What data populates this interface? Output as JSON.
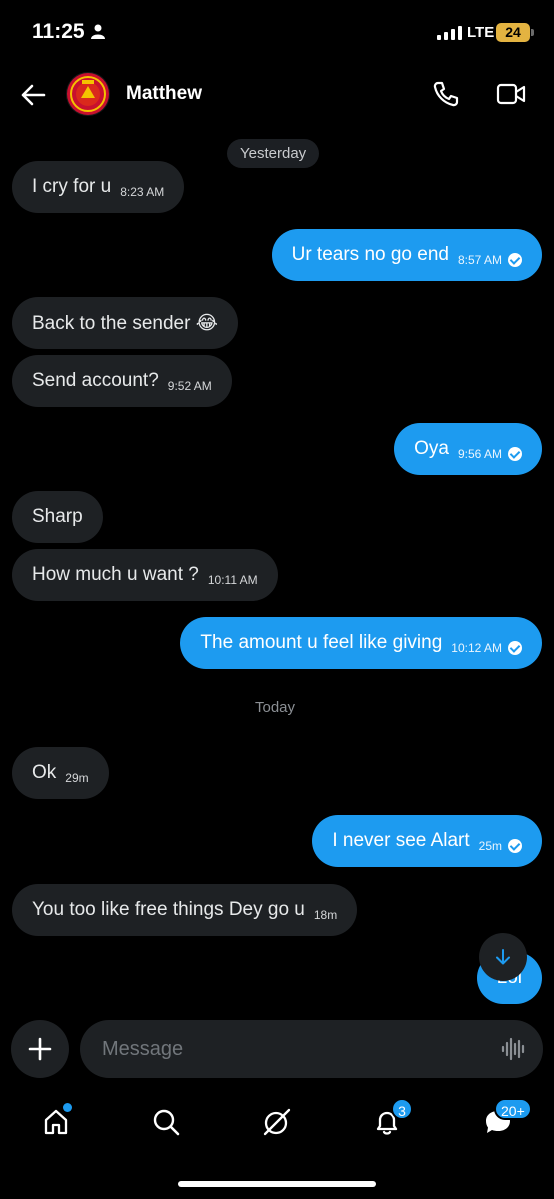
{
  "status_bar": {
    "time": "11:25",
    "network": "LTE",
    "battery": "24"
  },
  "header": {
    "contact_name": "Matthew"
  },
  "days": {
    "yesterday": "Yesterday",
    "today": "Today"
  },
  "messages": [
    {
      "direction": "in",
      "text": "I cry for u",
      "time": "8:23 AM"
    },
    {
      "direction": "out",
      "text": "Ur tears no go end",
      "time": "8:57 AM",
      "read": true
    },
    {
      "direction": "in",
      "text": "Back to the sender 😂",
      "time": ""
    },
    {
      "direction": "in",
      "text": "Send account?",
      "time": "9:52 AM"
    },
    {
      "direction": "out",
      "text": "Oya",
      "time": "9:56 AM",
      "read": true
    },
    {
      "direction": "in",
      "text": "Sharp",
      "time": ""
    },
    {
      "direction": "in",
      "text": "How much u want ?",
      "time": "10:11 AM"
    },
    {
      "direction": "out",
      "text": "The amount u feel like giving",
      "time": "10:12 AM",
      "read": true
    },
    {
      "direction": "in",
      "text": "Ok",
      "time": "29m"
    },
    {
      "direction": "out",
      "text": "I never see Alart",
      "time": "25m",
      "read": true
    },
    {
      "direction": "in",
      "text": "You too like free things Dey go u",
      "time": "18m"
    },
    {
      "direction": "out",
      "text": "Lol",
      "time": ""
    }
  ],
  "composer": {
    "placeholder": "Message"
  },
  "nav": {
    "items": [
      "home-icon",
      "search-icon",
      "grok-icon",
      "notifications-icon",
      "messages-icon"
    ],
    "notifications_badge": "3",
    "messages_badge": "20+"
  },
  "colors": {
    "accent": "#1d9bf0",
    "incoming_bubble": "#1e2124",
    "background": "#000000"
  }
}
